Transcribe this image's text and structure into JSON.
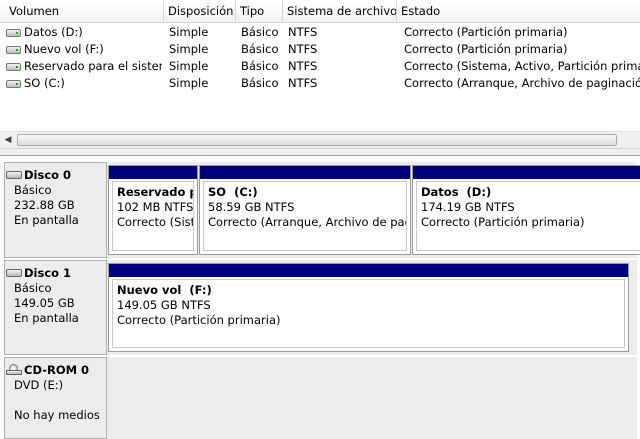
{
  "volume_list": {
    "columns": [
      "Volumen",
      "Disposición",
      "Tipo",
      "Sistema de archivos",
      "Estado"
    ],
    "rows": [
      {
        "volume": "Datos (D:)",
        "layout": "Simple",
        "type": "Básico",
        "fs": "NTFS",
        "status": "Correcto (Partición primaria)"
      },
      {
        "volume": "Nuevo vol (F:)",
        "layout": "Simple",
        "type": "Básico",
        "fs": "NTFS",
        "status": "Correcto (Partición primaria)"
      },
      {
        "volume": "Reservado para el sistema",
        "layout": "Simple",
        "type": "Básico",
        "fs": "NTFS",
        "status": "Correcto (Sistema, Activo, Partición primaria)"
      },
      {
        "volume": "SO (C:)",
        "layout": "Simple",
        "type": "Básico",
        "fs": "NTFS",
        "status": "Correcto (Arranque, Archivo de paginación, Volcado, Partición primaria)"
      }
    ],
    "icon": "drive-volume-icon"
  },
  "disks": [
    {
      "name": "Disco 0",
      "type": "Básico",
      "size": "232.88 GB",
      "state": "En pantalla",
      "icon": "hard-disk-icon",
      "partitions": [
        {
          "name": "Reservado para el sistema",
          "size": "102 MB NTFS",
          "status": "Correcto (Sistema, Activo, Partición primaria)"
        },
        {
          "name": "SO  (C:)",
          "size": "58.59 GB NTFS",
          "status": "Correcto (Arranque, Archivo de paginación, Volcado, Partición primaria)"
        },
        {
          "name": "Datos  (D:)",
          "size": "174.19 GB NTFS",
          "status": "Correcto (Partición primaria)"
        }
      ]
    },
    {
      "name": "Disco 1",
      "type": "Básico",
      "size": "149.05 GB",
      "state": "En pantalla",
      "icon": "hard-disk-icon",
      "partitions": [
        {
          "name": "Nuevo vol  (F:)",
          "size": "149.05 GB NTFS",
          "status": "Correcto (Partición primaria)"
        }
      ]
    },
    {
      "name": "CD-ROM 0",
      "type": "DVD (E:)",
      "state": "No hay medios",
      "icon": "cd-rom-icon"
    }
  ],
  "colors": {
    "primary_partition_bar": "#000080",
    "disk_label_bg": "#ececec"
  }
}
